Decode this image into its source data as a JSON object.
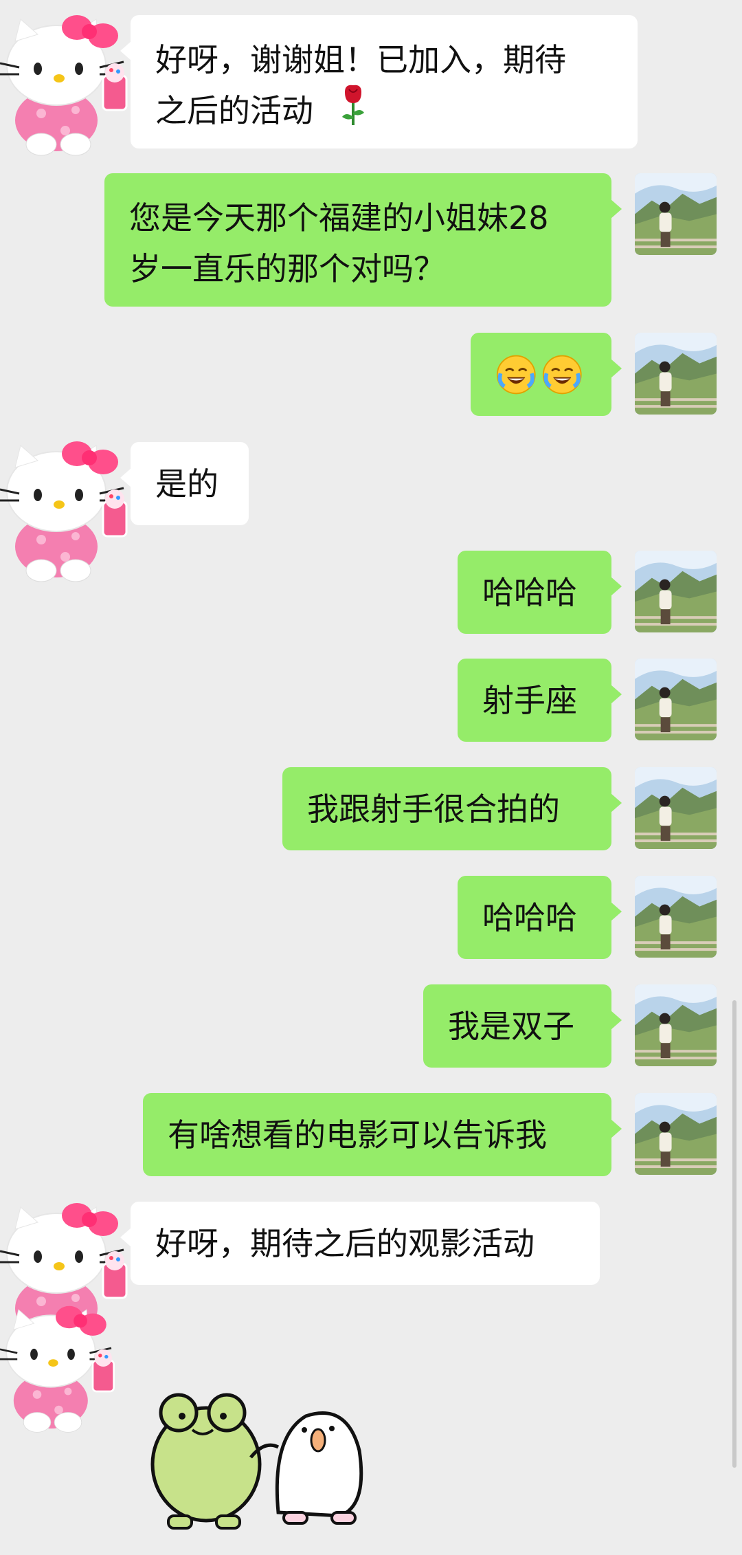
{
  "conversation": {
    "messages": [
      {
        "side": "in",
        "text": "好呀，谢谢姐！已加入，期待\n之后的活动",
        "emoji": "rose"
      },
      {
        "side": "out",
        "text": "您是今天那个福建的小姐妹28\n岁一直乐的那个对吗？"
      },
      {
        "side": "out",
        "emoji": "face-with-tears-of-joy x2"
      },
      {
        "side": "in",
        "text": "是的"
      },
      {
        "side": "out",
        "text": "哈哈哈"
      },
      {
        "side": "out",
        "text": "射手座"
      },
      {
        "side": "out",
        "text": "我跟射手很合拍的"
      },
      {
        "side": "out",
        "text": "哈哈哈"
      },
      {
        "side": "out",
        "text": "我是双子"
      },
      {
        "side": "out",
        "text": "有啥想看的电影可以告诉我"
      },
      {
        "side": "in",
        "text": "好呀，期待之后的观影活动"
      },
      {
        "side": "in",
        "sticker": "frog-and-duck-sticker"
      }
    ]
  },
  "colors": {
    "background": "#ededed",
    "outgoing_bubble": "#95ec69",
    "incoming_bubble": "#ffffff"
  }
}
